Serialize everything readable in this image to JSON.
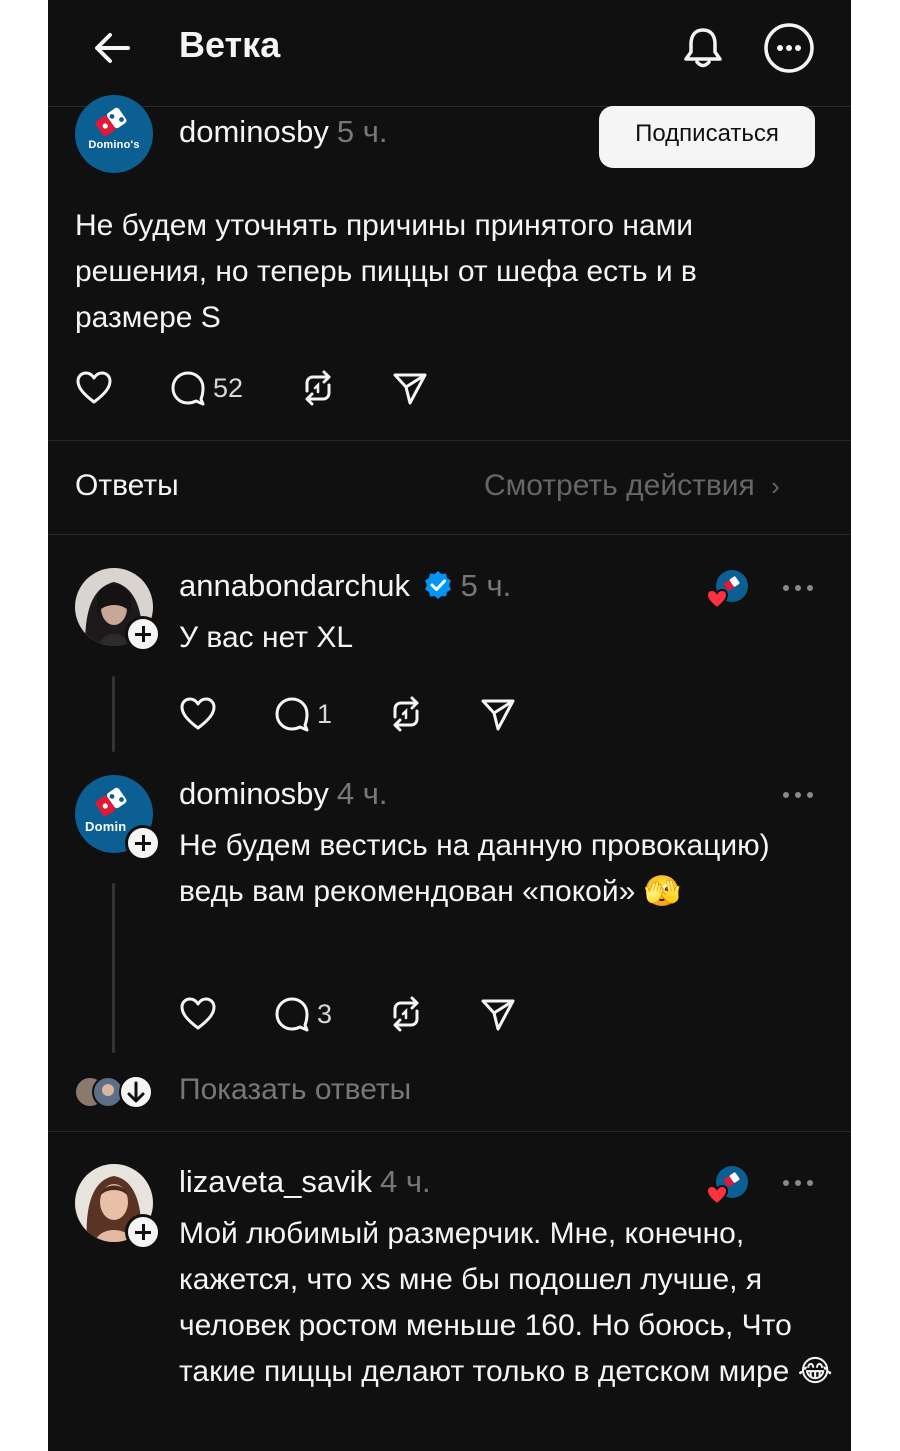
{
  "header": {
    "title": "Ветка"
  },
  "post": {
    "username": "dominosby",
    "time": "5 ч.",
    "follow_label": "Подписаться",
    "avatar_brand": "Domino's",
    "text": "Не будем уточнять причины принятого нами решения, но теперь пиццы от шефа есть и в размере S",
    "comments_count": "52"
  },
  "answers": {
    "label": "Ответы",
    "view_activity": "Смотреть действия"
  },
  "replies": [
    {
      "username": "annabondarchuk",
      "verified": true,
      "time": "5 ч.",
      "text": "У вас нет XL",
      "comments_count": "1",
      "liked_by_author": true
    },
    {
      "username": "dominosby",
      "time": "4 ч.",
      "avatar_brand": "Domin",
      "text": "Не будем вестись на данную провокацию) ведь вам рекомендован «покой»",
      "emoji": "🫣",
      "comments_count": "3",
      "show_replies": "Показать ответы"
    },
    {
      "username": "lizaveta_savik",
      "time": "4 ч.",
      "text": "Мой любимый размерчик. Мне, конечно, кажется, что xs мне бы подошел лучше, я человек ростом меньше 160. Но боюсь, Что такие пиццы делают только в детском мире",
      "emoji": "😂",
      "liked_by_author": true
    }
  ],
  "colors": {
    "background": "#101010",
    "text": "#f3f5f7",
    "muted": "#777777",
    "verified": "#0095f6",
    "like_red": "#ff3040",
    "brand_blue": "#0b5f93"
  }
}
